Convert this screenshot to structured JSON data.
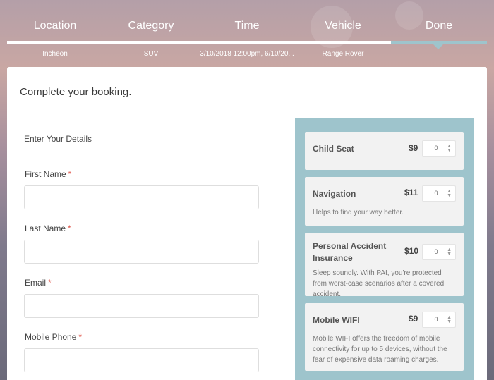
{
  "steps": [
    {
      "label": "Location",
      "value": "Incheon"
    },
    {
      "label": "Category",
      "value": "SUV"
    },
    {
      "label": "Time",
      "value": "3/10/2018 12:00pm, 6/10/20..."
    },
    {
      "label": "Vehicle",
      "value": "Range Rover"
    },
    {
      "label": "Done",
      "value": ""
    }
  ],
  "progress": {
    "fraction": 0.8
  },
  "card": {
    "title": "Complete your booking."
  },
  "details": {
    "heading": "Enter Your Details",
    "required_mark": "*",
    "fields": [
      {
        "label": "First Name",
        "value": ""
      },
      {
        "label": "Last Name",
        "value": ""
      },
      {
        "label": "Email",
        "value": ""
      },
      {
        "label": "Mobile Phone",
        "value": ""
      }
    ]
  },
  "extras": [
    {
      "name": "Child Seat",
      "price": "$9",
      "qty": "0",
      "desc": ""
    },
    {
      "name": "Navigation",
      "price": "$11",
      "qty": "0",
      "desc": "Helps to find your way better."
    },
    {
      "name": "Personal Accident Insurance",
      "price": "$10",
      "qty": "0",
      "desc": "Sleep soundly. With PAI, you're protected from worst-case scenarios after a covered accident."
    },
    {
      "name": "Mobile WIFI",
      "price": "$9",
      "qty": "0",
      "desc": "Mobile WIFI offers the freedom of mobile connectivity for up to 5 devices, without the fear of expensive data roaming charges."
    }
  ],
  "colors": {
    "accent": "#9ec4cc",
    "required": "#e05a4f"
  }
}
